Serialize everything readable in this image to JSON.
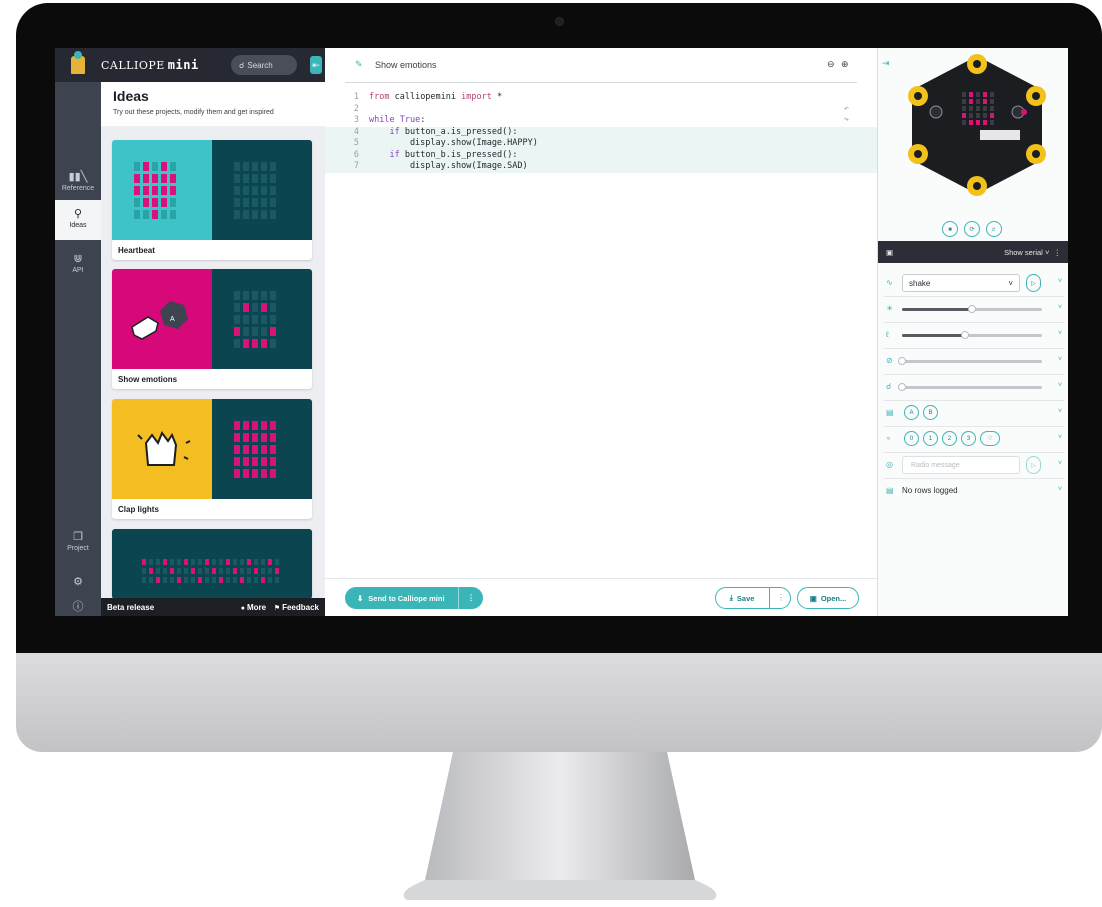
{
  "app": {
    "brand": "CALLIOPE",
    "brand_suffix": "mini",
    "search_label": "Search"
  },
  "rail": {
    "items": [
      {
        "label": "Reference",
        "icon": "books-icon"
      },
      {
        "label": "Ideas",
        "icon": "lightbulb-icon"
      },
      {
        "label": "API",
        "icon": "python-icon"
      },
      {
        "label": "Project",
        "icon": "files-icon"
      }
    ]
  },
  "ideas": {
    "title": "Ideas",
    "subtitle": "Try out these projects, modify them and get inspired",
    "cards": [
      {
        "label": "Heartbeat",
        "color": "#3ec4c8"
      },
      {
        "label": "Show emotions",
        "color": "#d6087a"
      },
      {
        "label": "Clap lights",
        "color": "#f4bd21"
      }
    ]
  },
  "footer": {
    "beta": "Beta release",
    "more": "More",
    "feedback": "Feedback"
  },
  "editor": {
    "title": "Show emotions",
    "lines": [
      {
        "n": "1",
        "code": "from calliopemini import *"
      },
      {
        "n": "2",
        "code": ""
      },
      {
        "n": "3",
        "code": "while True:"
      },
      {
        "n": "4",
        "code": "    if button_a.is_pressed():"
      },
      {
        "n": "5",
        "code": "        display.show(Image.HAPPY)"
      },
      {
        "n": "6",
        "code": "    if button_b.is_pressed():"
      },
      {
        "n": "7",
        "code": "        display.show(Image.SAD)"
      }
    ],
    "send_label": "Send to Calliope mini",
    "save_label": "Save",
    "open_label": "Open..."
  },
  "simulator": {
    "serial_label": "Show serial",
    "gesture_value": "shake",
    "sensor_levels": {
      "light": 0.5,
      "temperature": 0.45,
      "compass": 0.0,
      "sound": 0.0
    },
    "buttons": [
      "A",
      "B"
    ],
    "pins": [
      "0",
      "1",
      "2",
      "3"
    ],
    "radio_placeholder": "Radio message",
    "log_text": "No rows logged"
  },
  "colors": {
    "accent": "#3ab5b8",
    "led_on": "#d9127a",
    "dark": "#262932"
  }
}
